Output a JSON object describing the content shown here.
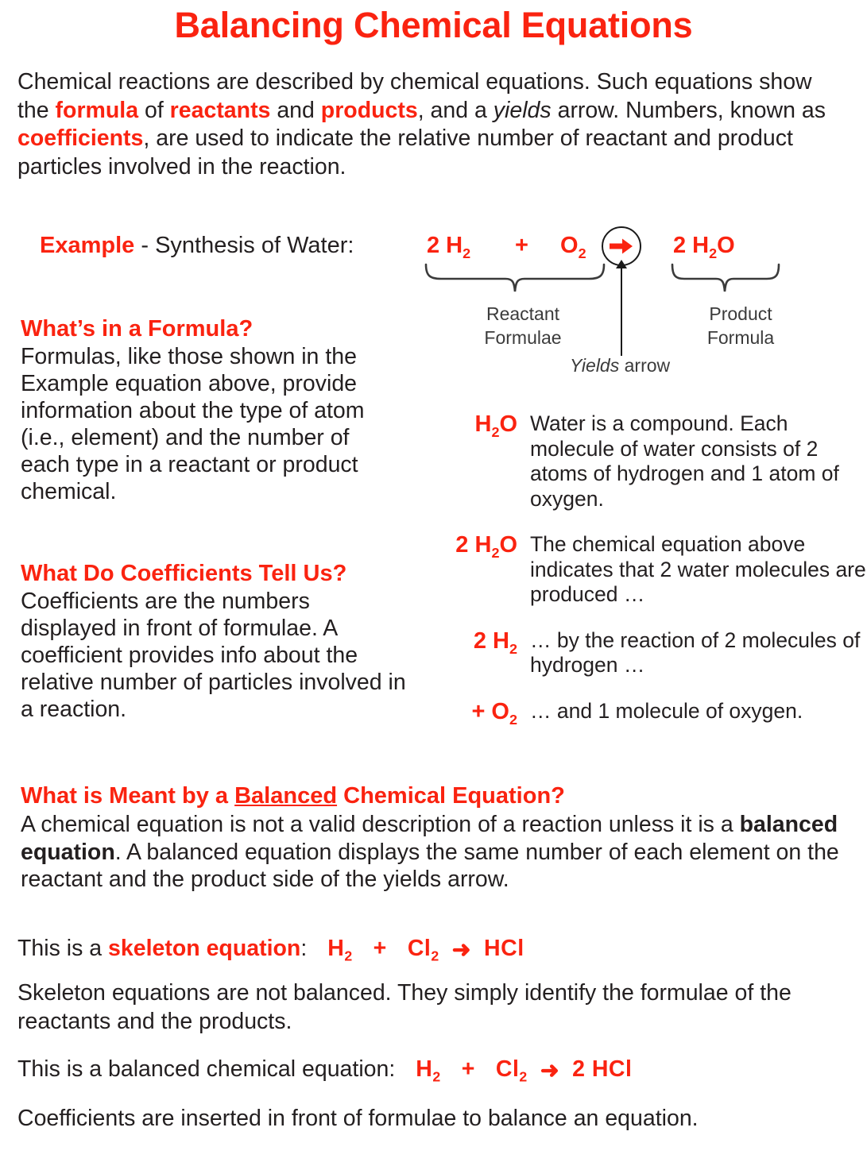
{
  "title": "Balancing Chemical Equations",
  "intro": {
    "p1": "Chemical reactions are described by chemical equations. Such equations show the ",
    "w_formula": "formula",
    "p2": " of ",
    "w_reactants": "reactants",
    "p3": " and ",
    "w_products": "products",
    "p4": ", and a ",
    "w_yields": "yields",
    "p5": " arrow. Numbers, known as ",
    "w_coefficients": "coefficients",
    "p6": ", are used to indicate the relative number of reactant and product particles involved in the reaction."
  },
  "example": {
    "label_red": "Example",
    "label_rest": " - Synthesis of Water:"
  },
  "equation_diagram": {
    "reactant_1_coef": "2 H",
    "reactant_1_sub": "2",
    "plus": "+",
    "reactant_2": "O",
    "reactant_2_sub": "2",
    "product_coef": "2 H",
    "product_sub": "2",
    "product_tail": "O",
    "arrow_icon": "yields-arrow-icon",
    "reactant_label_line1": "Reactant",
    "reactant_label_line2": "Formulae",
    "product_label_line1": "Product",
    "product_label_line2": "Formula",
    "yields_label_italic": "Yields",
    "yields_label_rest": " arrow"
  },
  "formula_section": {
    "heading": "What’s in a Formula?",
    "body": "Formulas, like those shown in the Example equation above, provide information about the type of atom (i.e., element) and the number of each type in a reactant or product chemical."
  },
  "coefficients_section": {
    "heading": "What Do Coefficients Tell Us?",
    "body": "Coefficients are the numbers displayed in front of formulae. A coefficient provides info about the relative number of particles involved in a reaction."
  },
  "formula_rows": [
    {
      "key_main": "H",
      "key_sub": "2",
      "key_tail": "O",
      "desc": "Water is a compound. Each molecule of water consists of 2 atoms of hydrogen and 1 atom of oxygen."
    },
    {
      "key_main": "2 H",
      "key_sub": "2",
      "key_tail": "O",
      "desc": "The chemical equation above indicates that 2 water molecules are produced …"
    },
    {
      "key_main": "2 H",
      "key_sub": "2",
      "key_tail": "",
      "desc": "… by the reaction of 2 molecules of hydrogen …"
    },
    {
      "key_main": "+  O",
      "key_sub": "2",
      "key_tail": "",
      "desc": "… and 1 molecule of oxygen."
    }
  ],
  "balanced_section": {
    "head_pre": "What is Meant by a ",
    "head_underlined": "Balanced",
    "head_post": " Chemical Equation?",
    "body_pre": "A chemical equation is not a valid description of a reaction unless it is a ",
    "body_bold": "balanced equation",
    "body_post": ". A balanced equation displays the same number of each element on the reactant and the product side of the yields arrow."
  },
  "skeleton": {
    "lead_pre": "This is a ",
    "lead_bold_red": "skeleton equation",
    "lead_post": ":",
    "eq_h2": "H",
    "eq_h2_sub": "2",
    "eq_plus": "+",
    "eq_cl2": "Cl",
    "eq_cl2_sub": "2",
    "eq_arrow": "➜",
    "eq_product": "HCl",
    "note": "Skeleton equations are not balanced. They simply identify the formulae of the reactants and the products."
  },
  "balanced_equation": {
    "lead": "This is a balanced chemical equation:",
    "eq_h2": "H",
    "eq_h2_sub": "2",
    "eq_plus": "+",
    "eq_cl2": "Cl",
    "eq_cl2_sub": "2",
    "eq_arrow": "➜",
    "eq_product": "2 HCl",
    "note": "Coefficients are inserted in front of formulae to balance an equation."
  },
  "colors": {
    "accent_red": "#fa2310",
    "text_dark": "#231f20",
    "label_gray": "#3b3b3b"
  }
}
